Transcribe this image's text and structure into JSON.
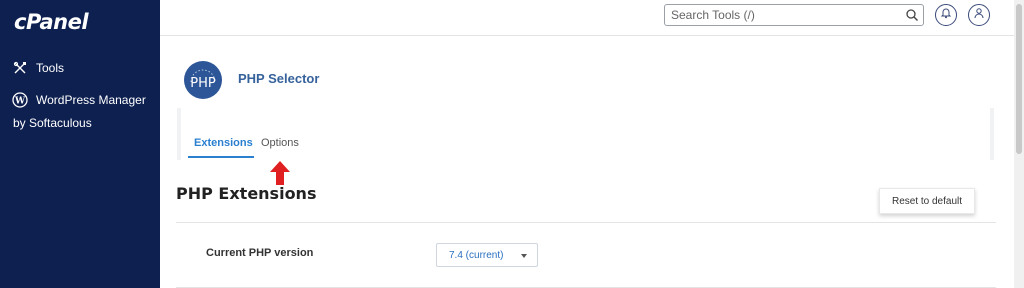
{
  "sidebar": {
    "logo": "cPanel",
    "items": [
      {
        "label": "Tools",
        "icon": "tools-icon"
      },
      {
        "label": "WordPress Manager",
        "icon": "wordpress-icon"
      }
    ],
    "wp_sublabel": "by Softaculous"
  },
  "header": {
    "search_placeholder": "Search Tools (/)",
    "icons": [
      "search-icon",
      "bell-icon",
      "user-icon"
    ]
  },
  "page": {
    "logo_text": "PHP",
    "title": "PHP Selector"
  },
  "tabs": [
    {
      "label": "Extensions",
      "active": true
    },
    {
      "label": "Options",
      "active": false
    }
  ],
  "section": {
    "title": "PHP Extensions",
    "reset_label": "Reset to default",
    "row_label": "Current PHP version",
    "version_value": "7.4 (current)"
  },
  "colors": {
    "sidebar_bg": "#0e2050",
    "accent_blue": "#2a7fcf",
    "title_blue": "#36629b",
    "arrow_red": "#e02020"
  }
}
